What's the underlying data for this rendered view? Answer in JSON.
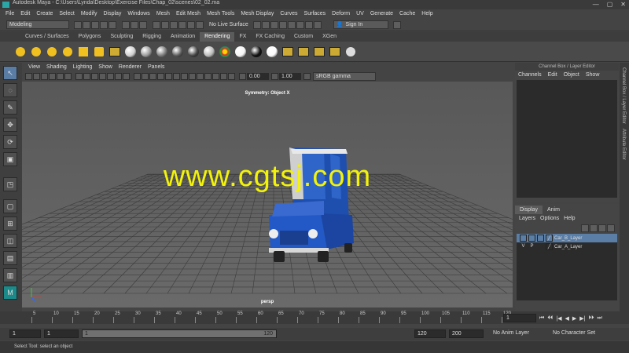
{
  "window": {
    "title": "Autodesk Maya - C:\\Users\\Lynda\\Desktop\\Exercise Files\\Chap_02\\scenes\\02_02.ma",
    "controls": [
      "—",
      "▢",
      "✕"
    ]
  },
  "menubar": [
    "File",
    "Edit",
    "Create",
    "Select",
    "Modify",
    "Display",
    "Windows",
    "Mesh",
    "Edit Mesh",
    "Mesh Tools",
    "Mesh Display",
    "Curves",
    "Surfaces",
    "Deform",
    "UV",
    "Generate",
    "Cache",
    "Help"
  ],
  "statusline": {
    "mode": "Modeling",
    "live_surface": "No Live Surface",
    "sign_in": "Sign In"
  },
  "shelf_tabs": [
    "Curves / Surfaces",
    "Polygons",
    "Sculpting",
    "Rigging",
    "Animation",
    "Rendering",
    "FX",
    "FX Caching",
    "Custom",
    "XGen"
  ],
  "shelf_active": "Rendering",
  "shelf_ball_colors": [
    "#d0d0d0",
    "#9a9a9a",
    "#7a7a7a",
    "#5a5a5a",
    "#444444",
    "#bbbbbb",
    "#e04040",
    "#f5f5f5",
    "#111111",
    "#fafafa"
  ],
  "viewport_menu": [
    "View",
    "Shading",
    "Lighting",
    "Show",
    "Renderer",
    "Panels"
  ],
  "viewport_toolbar": {
    "exposure": "0.00",
    "gamma": "1.00",
    "colorspace": "sRGB gamma"
  },
  "viewport": {
    "symmetry": "Symmetry: Object X",
    "camera": "persp",
    "watermark": "www.cgtsj.com"
  },
  "channel_box": {
    "title": "Channel Box / Layer Editor",
    "menu": [
      "Channels",
      "Edit",
      "Object",
      "Show"
    ]
  },
  "side_tabs": [
    "Channel Box / Layer Editor",
    "Attribute Editor"
  ],
  "layer_editor": {
    "tabs": [
      "Display",
      "Anim"
    ],
    "active_tab": "Display",
    "menu": [
      "Layers",
      "Options",
      "Help"
    ],
    "layers": [
      {
        "v": "",
        "p": "",
        "name": "Car_B_Layer",
        "selected": true
      },
      {
        "v": "V",
        "p": "P",
        "name": "Car_A_Layer",
        "selected": false
      }
    ]
  },
  "timeline": {
    "ticks": [
      "5",
      "10",
      "15",
      "20",
      "25",
      "30",
      "35",
      "40",
      "45",
      "50",
      "55",
      "60",
      "65",
      "70",
      "75",
      "80",
      "85",
      "90",
      "95",
      "100",
      "105",
      "110",
      "115",
      "120"
    ],
    "current_frame": "1"
  },
  "range": {
    "start": "1",
    "anim_start": "1",
    "slider_start": "1",
    "slider_end": "120",
    "end": "120",
    "anim_end": "200",
    "anim_layer": "No Anim Layer",
    "char_set": "No Character Set"
  },
  "playback_glyphs": [
    "⏮",
    "⏴⏴",
    "|◀",
    "◀",
    "▶",
    "▶|",
    "⏵⏵",
    "⏭"
  ],
  "help_line": "Select Tool: select an object"
}
